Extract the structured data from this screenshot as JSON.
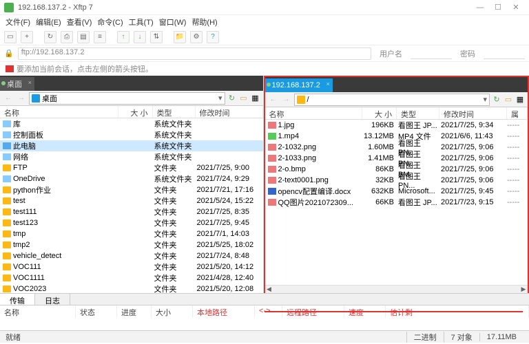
{
  "window": {
    "title": "192.168.137.2 - Xftp 7"
  },
  "menu": [
    "文件(F)",
    "编辑(E)",
    "查看(V)",
    "命令(C)",
    "工具(T)",
    "窗口(W)",
    "帮助(H)"
  ],
  "addr": {
    "url": "ftp://192.168.137.2",
    "user_lbl": "用户名",
    "pass_lbl": "密码"
  },
  "hint": "要添加当前会话，点击左侧的箭头按钮。",
  "local": {
    "tab": "桌面",
    "path": "桌面",
    "cols": {
      "name": "名称",
      "size": "大 小",
      "type": "类型",
      "date": "修改时间"
    },
    "rows": [
      {
        "n": "库",
        "t": "系统文件夹",
        "ico": "sys"
      },
      {
        "n": "控制面板",
        "t": "系统文件夹",
        "ico": "sys"
      },
      {
        "n": "此电脑",
        "t": "系统文件夹",
        "ico": "pc",
        "sel": true
      },
      {
        "n": "网络",
        "t": "系统文件夹",
        "ico": "sys"
      },
      {
        "n": "FTP",
        "t": "文件夹",
        "d": "2021/7/25, 9:00",
        "ico": "folder"
      },
      {
        "n": "OneDrive",
        "t": "系统文件夹",
        "d": "2021/7/24, 9:29",
        "ico": "sys"
      },
      {
        "n": "python作业",
        "t": "文件夹",
        "d": "2021/7/21, 17:16",
        "ico": "folder"
      },
      {
        "n": "test",
        "t": "文件夹",
        "d": "2021/5/24, 15:22",
        "ico": "folder"
      },
      {
        "n": "test111",
        "t": "文件夹",
        "d": "2021/7/25, 8:35",
        "ico": "folder"
      },
      {
        "n": "test123",
        "t": "文件夹",
        "d": "2021/7/25, 9:45",
        "ico": "folder"
      },
      {
        "n": "tmp",
        "t": "文件夹",
        "d": "2021/7/1, 14:03",
        "ico": "folder"
      },
      {
        "n": "tmp2",
        "t": "文件夹",
        "d": "2021/5/25, 18:02",
        "ico": "folder"
      },
      {
        "n": "vehicle_detect",
        "t": "文件夹",
        "d": "2021/7/24, 8:48",
        "ico": "folder"
      },
      {
        "n": "VOC111",
        "t": "文件夹",
        "d": "2021/5/20, 14:12",
        "ico": "folder"
      },
      {
        "n": "VOC1111",
        "t": "文件夹",
        "d": "2021/4/28, 12:40",
        "ico": "folder"
      },
      {
        "n": "VOC2023",
        "t": "文件夹",
        "d": "2021/5/20, 12:08",
        "ico": "folder"
      }
    ]
  },
  "remote": {
    "tab": "192.168.137.2",
    "path": "/",
    "cols": {
      "name": "名称",
      "size": "大 小",
      "type": "类型",
      "date": "修改时间",
      "attr": "属性"
    },
    "rows": [
      {
        "n": "1.jpg",
        "s": "196KB",
        "t": "看图王 JP...",
        "d": "2021/7/25, 9:34",
        "ico": "img"
      },
      {
        "n": "1.mp4",
        "s": "13.12MB",
        "t": "MP4 文件",
        "d": "2021/6/6, 11:43",
        "ico": "mp4"
      },
      {
        "n": "2-1032.png",
        "s": "1.60MB",
        "t": "看图王 PN...",
        "d": "2021/7/25, 9:06",
        "ico": "img"
      },
      {
        "n": "2-1033.png",
        "s": "1.41MB",
        "t": "看图王 PN...",
        "d": "2021/7/25, 9:06",
        "ico": "img"
      },
      {
        "n": "2-o.bmp",
        "s": "86KB",
        "t": "看图王 BM...",
        "d": "2021/7/25, 9:06",
        "ico": "img"
      },
      {
        "n": "2-text0001.png",
        "s": "32KB",
        "t": "看图王 PN...",
        "d": "2021/7/25, 9:06",
        "ico": "img"
      },
      {
        "n": "opencv配置编译.docx",
        "s": "632KB",
        "t": "Microsoft...",
        "d": "2021/7/25, 9:45",
        "ico": "doc"
      },
      {
        "n": "QQ图片2021072309...",
        "s": "66KB",
        "t": "看图王 JP...",
        "d": "2021/7/23, 9:15",
        "ico": "img"
      }
    ]
  },
  "btabs": {
    "transfer": "传输",
    "log": "日志"
  },
  "thdrs": {
    "name": "名称",
    "status": "状态",
    "progress": "进度",
    "size": "大小",
    "local": "本地路径",
    "arrow": "<->",
    "remote": "远程路径",
    "speed": "速度",
    "est": "估计剩"
  },
  "status": {
    "ready": "就绪",
    "binary": "二进制",
    "objects": "7 对象",
    "total": "17.11MB"
  }
}
